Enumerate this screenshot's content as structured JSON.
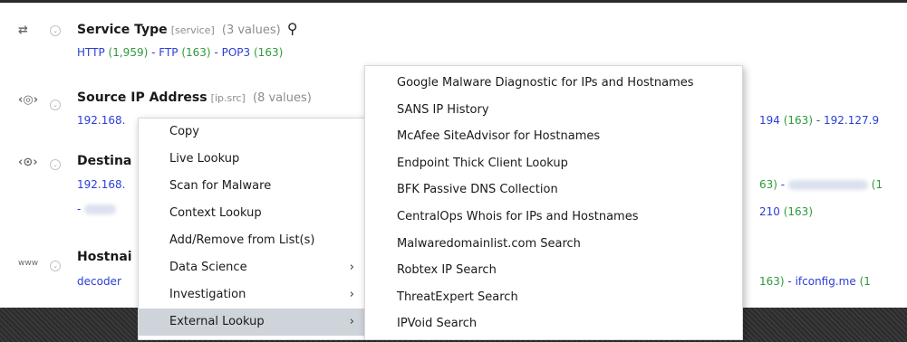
{
  "meta": [
    {
      "icon": "arrows-exchange-icon",
      "glyph": "⇄",
      "name": "Service Type",
      "key": "[service]",
      "count": "(3 values)",
      "values": [
        {
          "label": "HTTP",
          "count": "(1,959)"
        },
        {
          "label": "FTP",
          "count": "(163)"
        },
        {
          "label": "POP3",
          "count": "(163)"
        }
      ]
    },
    {
      "icon": "ip-address-icon",
      "glyph": "‹◎›",
      "name": "Source IP Address",
      "key": "[ip.src]",
      "count": "(8 values)",
      "value_left": "192.168.",
      "value_right_1": "194",
      "value_right_1_count": "(163)",
      "value_right_2": "192.127.9"
    },
    {
      "icon": "location-pin-icon",
      "glyph": "‹⊙›",
      "name": "Destina",
      "value_left": "192.168.",
      "value_left2": "-",
      "value_right_count": "63)",
      "value_right_tail": "(1",
      "value_right_line2": "210",
      "value_right_line2_count": "(163)"
    },
    {
      "icon": "www-icon",
      "glyph": "www",
      "name": "Hostnai",
      "value_left": "decoder",
      "value_right_count": "163)",
      "value_right_2": "ifconfig.me",
      "value_right_2_tail": "(1"
    }
  ],
  "context_menu": {
    "items": [
      {
        "label": "Copy",
        "submenu": false
      },
      {
        "label": "Live Lookup",
        "submenu": false
      },
      {
        "label": "Scan for Malware",
        "submenu": false
      },
      {
        "label": "Context Lookup",
        "submenu": false
      },
      {
        "label": "Add/Remove from List(s)",
        "submenu": false
      },
      {
        "label": "Data Science",
        "submenu": true
      },
      {
        "label": "Investigation",
        "submenu": true
      },
      {
        "label": "External Lookup",
        "submenu": true,
        "active": true
      }
    ],
    "arrow_glyph": "›"
  },
  "external_lookup_menu": {
    "items": [
      "Google Malware Diagnostic for IPs and Hostnames",
      "SANS IP History",
      "McAfee SiteAdvisor for Hostnames",
      "Endpoint Thick Client Lookup",
      "BFK Passive DNS Collection",
      "CentralOps Whois for IPs and Hostnames",
      "Malwaredomainlist.com Search",
      "Robtex IP Search",
      "ThreatExpert Search",
      "IPVoid Search"
    ]
  },
  "colors": {
    "value_link": "#2a3ed8",
    "count_green": "#2d9a3b",
    "menu_active_bg": "#cfd3da"
  }
}
